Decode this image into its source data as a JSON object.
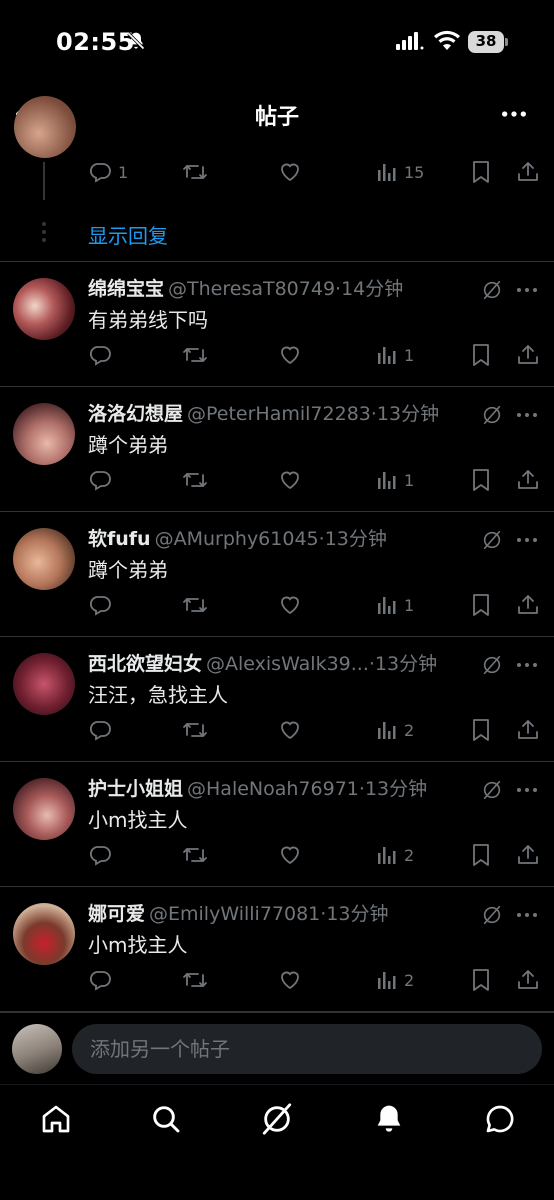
{
  "status_bar": {
    "time": "02:55",
    "battery": "38"
  },
  "header": {
    "title": "帖子"
  },
  "top_reply": {
    "stats": {
      "replies": "1",
      "reposts": "",
      "likes": "",
      "views": "15"
    },
    "show_replies": "显示回复"
  },
  "tweets": [
    {
      "name": "绵绵宝宝",
      "handle": "@TheresaT80749",
      "time": "14分钟",
      "text": "有弟弟线下吗",
      "stats": {
        "replies": "",
        "reposts": "",
        "likes": "",
        "views": "1"
      }
    },
    {
      "name": "洛洛幻想屋",
      "handle": "@PeterHamil72283",
      "time": "13分钟",
      "text": "蹲个弟弟",
      "stats": {
        "replies": "",
        "reposts": "",
        "likes": "",
        "views": "1"
      }
    },
    {
      "name": "软fufu",
      "handle": "@AMurphy61045",
      "time": "13分钟",
      "text": "蹲个弟弟",
      "stats": {
        "replies": "",
        "reposts": "",
        "likes": "",
        "views": "1"
      }
    },
    {
      "name": "西北欲望妇女",
      "handle": "@AlexisWalk39...",
      "time": "13分钟",
      "text": "汪汪，急找主人",
      "stats": {
        "replies": "",
        "reposts": "",
        "likes": "",
        "views": "2"
      }
    },
    {
      "name": "护士小姐姐",
      "handle": "@HaleNoah76971",
      "time": "13分钟",
      "text": "小m找主人",
      "stats": {
        "replies": "",
        "reposts": "",
        "likes": "",
        "views": "2"
      }
    },
    {
      "name": "娜可爱",
      "handle": "@EmilyWilli77081",
      "time": "13分钟",
      "text": "小m找主人",
      "stats": {
        "replies": "",
        "reposts": "",
        "likes": "",
        "views": "2"
      }
    }
  ],
  "composer": {
    "placeholder": "添加另一个帖子"
  },
  "tabbar": {
    "items": [
      "home-icon",
      "search-icon",
      "grok-icon",
      "notifications-icon",
      "messages-icon"
    ]
  },
  "colors": {
    "background": "#000000",
    "accent": "#1d9bf0",
    "muted": "#71767b",
    "divider": "#2f3336",
    "text": "#e7e9ea"
  }
}
